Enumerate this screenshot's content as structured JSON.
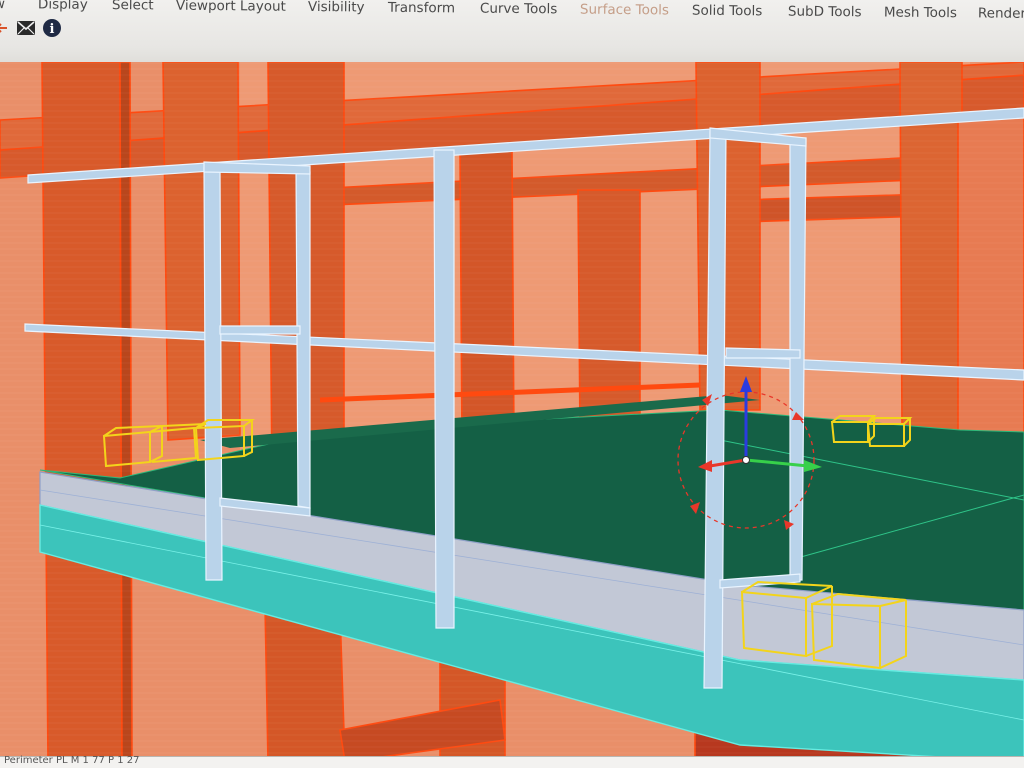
{
  "menu": {
    "tabs": [
      {
        "label": "w"
      },
      {
        "label": "Display"
      },
      {
        "label": "Select"
      },
      {
        "label": "Viewport Layout"
      },
      {
        "label": "Visibility"
      },
      {
        "label": "Transform"
      },
      {
        "label": "Curve Tools"
      },
      {
        "label": "Surface Tools",
        "active": true
      },
      {
        "label": "Solid Tools"
      },
      {
        "label": "SubD Tools"
      },
      {
        "label": "Mesh Tools"
      },
      {
        "label": "Render"
      }
    ]
  },
  "toolbar": {
    "icons": [
      "back-arrow-icon",
      "mail-icon",
      "info-icon"
    ],
    "info_glyph": "i"
  },
  "viewport": {
    "colors": {
      "background": "#e88a64",
      "structure": "#d95a2a",
      "structure_edge": "#ff4a10",
      "floor": "#146045",
      "railing": "#b9d3ea",
      "slab_edge": "#49d6cf",
      "selection": "#f3d41b",
      "gizmo_x": "#e8372a",
      "gizmo_y": "#37d04a",
      "gizmo_z": "#2b3be0"
    }
  },
  "status": {
    "text": "Perimeter  PL  M  1 77 P 1 27"
  }
}
